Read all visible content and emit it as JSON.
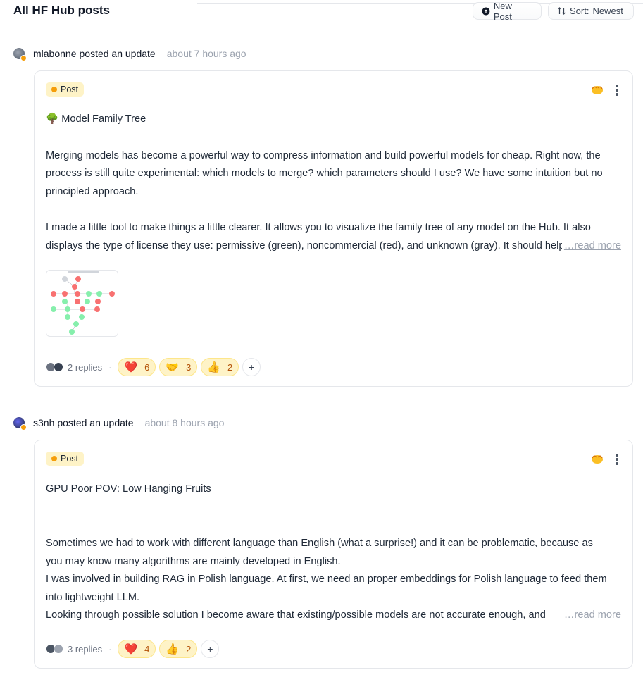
{
  "header": {
    "title": "All HF Hub posts",
    "new_post_label": "New Post",
    "sort_label": "Sort:",
    "sort_value": "Newest"
  },
  "posts": [
    {
      "author": "mlabonne",
      "verb": "posted an update",
      "time": "about 7 hours ago",
      "badge": "Post",
      "lines": [
        "🌳 Model Family Tree",
        "",
        "Merging models has become a powerful way to compress information and build powerful models for cheap. Right now, the",
        "process is still quite experimental: which models to merge? which parameters should I use? We have some intuition but no",
        "principled approach.",
        "",
        "I made a little tool to make things a little clearer. It allows you to visualize the family tree of any model on the Hub. It also",
        "displays the type of license they use: permissive (green), noncommercial (red), and unknown (gray). It should help"
      ],
      "read_more_ellipsis": "…",
      "read_more": "read more",
      "replies": "2 replies",
      "reactions": [
        {
          "emoji": "❤️",
          "count": "6"
        },
        {
          "emoji": "🤝",
          "count": "3"
        },
        {
          "emoji": "👍",
          "count": "2"
        }
      ],
      "add_reaction": "+"
    },
    {
      "author": "s3nh",
      "verb": "posted an update",
      "time": "about 8 hours ago",
      "badge": "Post",
      "lines": [
        "GPU Poor POV: Low Hanging Fruits",
        "",
        "",
        "Sometimes we had to work with different language than English (what a surprise!) and it can be problematic, because as",
        "you may know many algorithms are mainly developed in English.",
        "I was involved in building RAG in Polish language. At first, we need an proper embeddings for Polish language to feed them",
        "into lightweight LLM.",
        "Looking through possible solution I become aware that existing/possible models are not accurate enough, and"
      ],
      "read_more_ellipsis": "…",
      "read_more": "read more",
      "replies": "3 replies",
      "reactions": [
        {
          "emoji": "❤️",
          "count": "4"
        },
        {
          "emoji": "👍",
          "count": "2"
        }
      ],
      "add_reaction": "+"
    }
  ],
  "colors": {
    "badge_bg": "#fef3c7",
    "accent": "#f59e0b",
    "muted_text": "#9ca3af",
    "border": "#e5e7eb"
  }
}
